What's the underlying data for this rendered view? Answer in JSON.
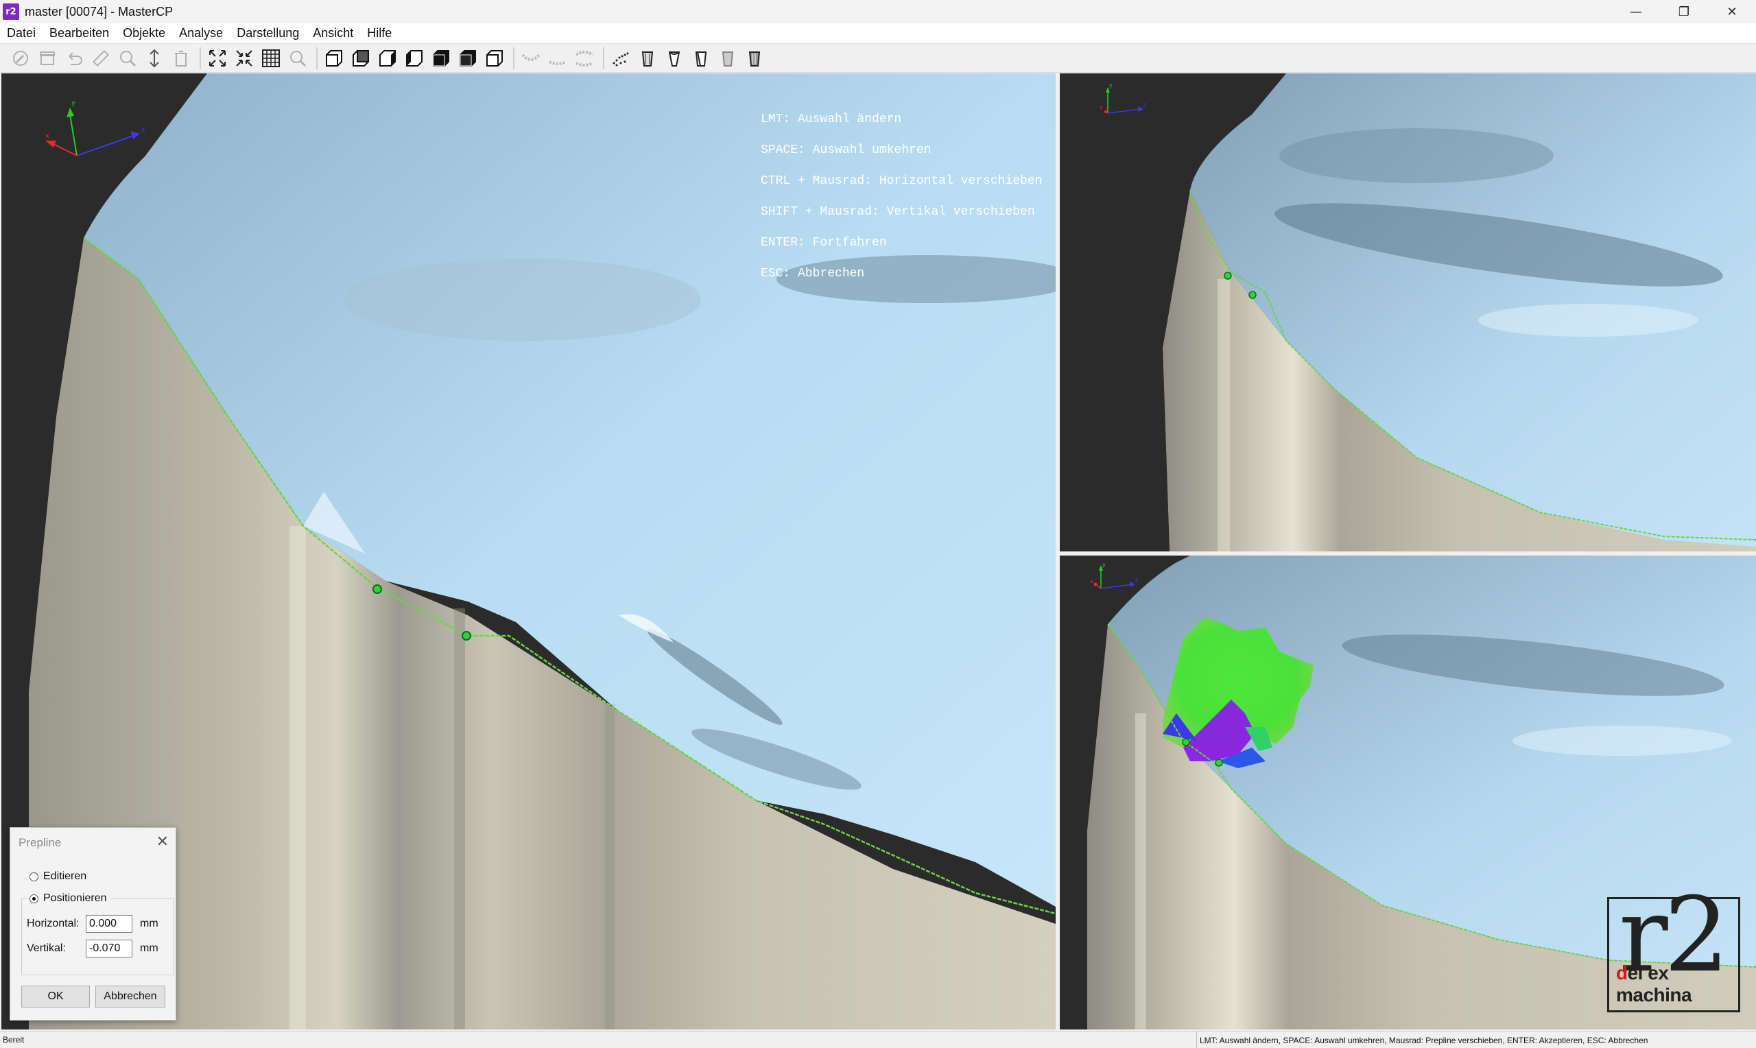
{
  "window": {
    "icon_text": "r2",
    "title": "master [00074] - MasterCP",
    "minimize_glyph": "—",
    "maximize_glyph": "❐",
    "close_glyph": "✕"
  },
  "menu": [
    "Datei",
    "Bearbeiten",
    "Objekte",
    "Analyse",
    "Darstellung",
    "Ansicht",
    "Hilfe"
  ],
  "toolbar_icons": [
    "tool-icon",
    "box-icon",
    "undo-icon",
    "ruler-icon",
    "zoom-region-icon",
    "vertical-arrow-icon",
    "delete-icon",
    "fit-view-icon",
    "shrink-view-icon",
    "grid-icon",
    "magnifier-icon",
    "view-front-icon",
    "view-back-icon",
    "view-left-icon",
    "view-right-icon",
    "view-top-icon",
    "view-bottom-icon",
    "view-iso-icon",
    "arch-icon-1",
    "arch-icon-2",
    "arch-icon-3",
    "points-icon",
    "tooth-icon-1",
    "tooth-icon-2",
    "tooth-icon-3",
    "tooth-icon-4",
    "tooth-icon-5"
  ],
  "viewport_main": {
    "instructions": [
      "LMT: Auswahl ändern",
      "SPACE: Auswahl umkehren",
      "CTRL + Mausrad: Horizontal verschieben",
      "SHIFT + Mausrad: Vertikal verschieben",
      "ENTER: Fortfahren",
      "ESC: Abbrechen"
    ]
  },
  "axis_labels": {
    "x": "x",
    "y": "y",
    "z": "z"
  },
  "logo": {
    "main": "r2",
    "sub_first": "d",
    "sub_rest": "ei ex machina"
  },
  "dialog": {
    "title": "Prepline",
    "close": "✕",
    "option_edit": "Editieren",
    "option_position": "Positionieren",
    "selected_option": "Positionieren",
    "horizontal_label": "Horizontal:",
    "horizontal_value": "0.000",
    "vertical_label": "Vertikal:",
    "vertical_value": "-0.070",
    "unit": "mm",
    "ok_label": "OK",
    "cancel_label": "Abbrechen"
  },
  "status": {
    "left": "Bereit",
    "right": "LMT: Auswahl ändern, SPACE: Auswahl umkehren, Mausrad: Prepline verschieben, ENTER: Akzeptieren, ESC: Abbrechen"
  },
  "colors": {
    "background": "#2b2b2b",
    "surface_blue": "#b5d6ea",
    "surface_beige": "#d2cfbf",
    "prepline_green": "#6fd14a",
    "point_green": "#2fd23a",
    "highlight_purple": "#8b1ee6"
  }
}
